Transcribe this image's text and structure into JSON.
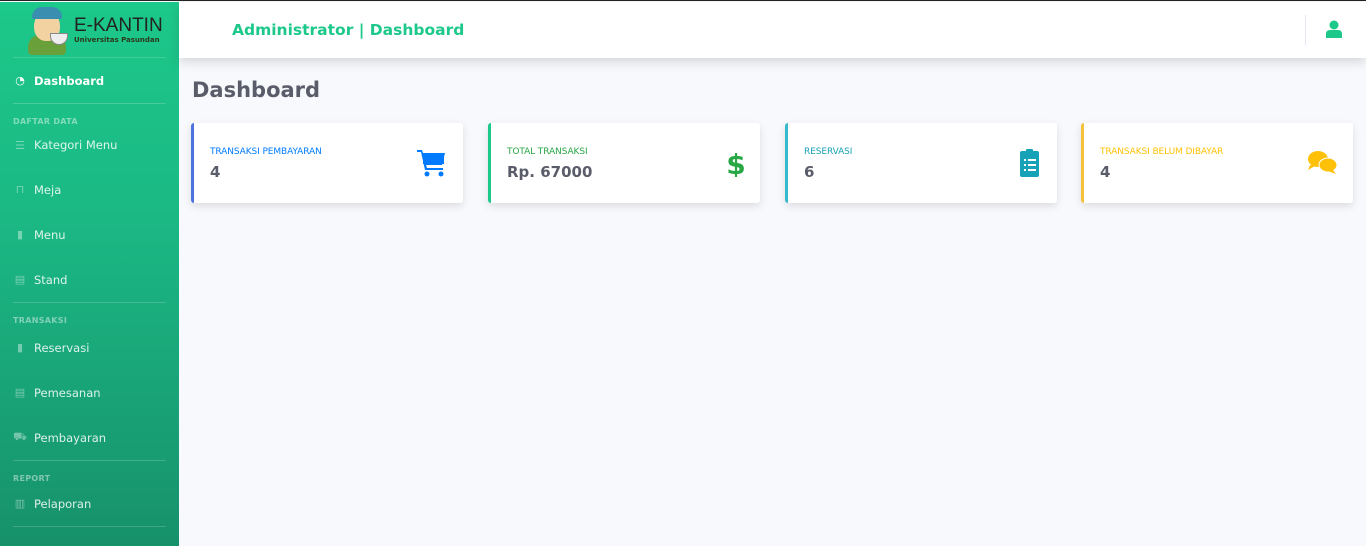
{
  "brand": {
    "name": "E-KANTIN",
    "subtitle": "Universitas Pasundan"
  },
  "sidebar": {
    "dashboard": "Dashboard",
    "sections": [
      {
        "heading": "DAFTAR DATA",
        "items": [
          "Kategori Menu",
          "Meja",
          "Menu",
          "Stand"
        ]
      },
      {
        "heading": "TRANSAKSI",
        "items": [
          "Reservasi",
          "Pemesanan",
          "Pembayaran"
        ]
      },
      {
        "heading": "REPORT",
        "items": [
          "Pelaporan"
        ]
      }
    ]
  },
  "topbar": {
    "title": "Administrator | Dashboard"
  },
  "page": {
    "title": "Dashboard"
  },
  "cards": [
    {
      "label": "Transaksi Pembayaran",
      "value": "4",
      "color": "#4e73df",
      "label_color": "#007bff",
      "icon": "cart-icon"
    },
    {
      "label": "Total Transaksi",
      "value": "Rp. 67000",
      "color": "#1cc88a",
      "label_color": "#28a745",
      "icon": "dollar-icon"
    },
    {
      "label": "Reservasi",
      "value": "6",
      "color": "#36b9cc",
      "label_color": "#17a2b8",
      "icon": "clipboard-list-icon"
    },
    {
      "label": "Transaksi Belum Dibayar",
      "value": "4",
      "color": "#f6c23e",
      "label_color": "#ffc107",
      "icon": "comments-icon"
    }
  ]
}
